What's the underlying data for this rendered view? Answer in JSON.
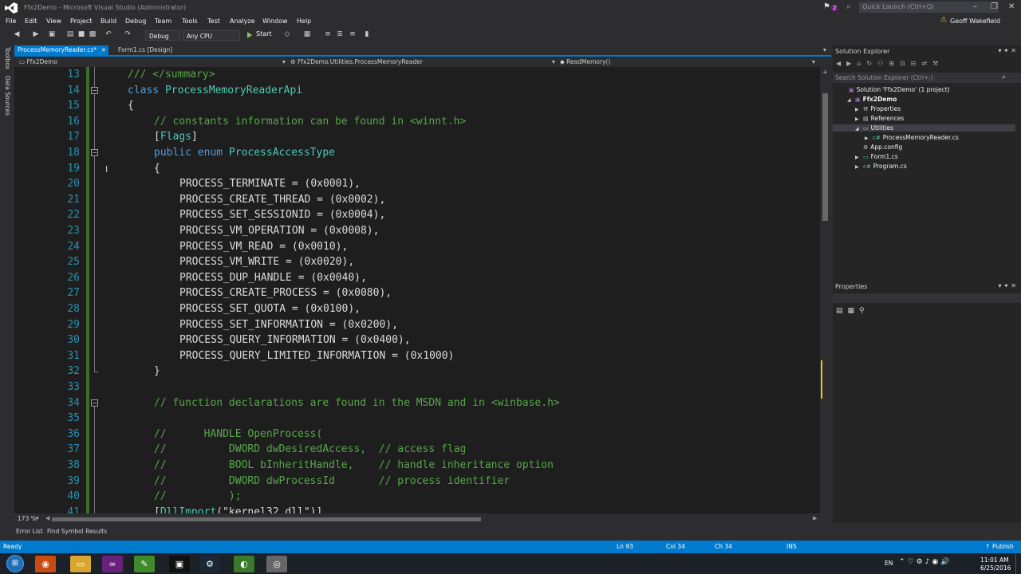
{
  "window": {
    "title": "Ffx2Demo - Microsoft Visual Studio (Administrator)",
    "notifications_count": "2",
    "quick_launch_placeholder": "Quick Launch (Ctrl+Q)",
    "user": "Geoff Wakefield"
  },
  "menu": [
    "File",
    "Edit",
    "View",
    "Project",
    "Build",
    "Debug",
    "Team",
    "Tools",
    "Test",
    "Analyze",
    "Window",
    "Help"
  ],
  "toolbar": {
    "config": "Debug",
    "platform": "Any CPU",
    "start_label": "Start"
  },
  "left_strip": {
    "toolbox": "Toolbox",
    "data_sources": "Data Sources"
  },
  "tabs": [
    {
      "label": "ProcessMemoryReader.cs*",
      "active": true
    },
    {
      "label": "Form1.cs [Design]",
      "active": false
    }
  ],
  "navbar": {
    "project": "Ffx2Demo",
    "class": "Ffx2Demo.Utilities.ProcessMemoryReader",
    "member": "ReadMemory()"
  },
  "code_lines": [
    {
      "num": "13",
      "indent": 0,
      "parts": [
        {
          "t": "/// </summary>",
          "c": "cm"
        }
      ]
    },
    {
      "num": "14",
      "indent": 0,
      "parts": [
        {
          "t": "class ",
          "c": "kw"
        },
        {
          "t": "ProcessMemoryReaderApi",
          "c": "ty"
        }
      ]
    },
    {
      "num": "15",
      "indent": 0,
      "parts": [
        {
          "t": "{",
          "c": "pl"
        }
      ]
    },
    {
      "num": "16",
      "indent": 1,
      "parts": [
        {
          "t": "// constants information can be found in <winnt.h>",
          "c": "cm"
        }
      ]
    },
    {
      "num": "17",
      "indent": 1,
      "parts": [
        {
          "t": "[",
          "c": "pl"
        },
        {
          "t": "Flags",
          "c": "ty"
        },
        {
          "t": "]",
          "c": "pl"
        }
      ]
    },
    {
      "num": "18",
      "indent": 1,
      "parts": [
        {
          "t": "public enum ",
          "c": "kw"
        },
        {
          "t": "ProcessAccessType",
          "c": "ty"
        }
      ]
    },
    {
      "num": "19",
      "indent": 1,
      "parts": [
        {
          "t": "{",
          "c": "pl"
        }
      ]
    },
    {
      "num": "20",
      "indent": 2,
      "parts": [
        {
          "t": "PROCESS_TERMINATE = (0x0001),",
          "c": "pl"
        }
      ]
    },
    {
      "num": "21",
      "indent": 2,
      "parts": [
        {
          "t": "PROCESS_CREATE_THREAD = (0x0002),",
          "c": "pl"
        }
      ]
    },
    {
      "num": "22",
      "indent": 2,
      "parts": [
        {
          "t": "PROCESS_SET_SESSIONID = (0x0004),",
          "c": "pl"
        }
      ]
    },
    {
      "num": "23",
      "indent": 2,
      "parts": [
        {
          "t": "PROCESS_VM_OPERATION = (0x0008),",
          "c": "pl"
        }
      ]
    },
    {
      "num": "24",
      "indent": 2,
      "parts": [
        {
          "t": "PROCESS_VM_READ = (0x0010),",
          "c": "pl"
        }
      ]
    },
    {
      "num": "25",
      "indent": 2,
      "parts": [
        {
          "t": "PROCESS_VM_WRITE = (0x0020),",
          "c": "pl"
        }
      ]
    },
    {
      "num": "26",
      "indent": 2,
      "parts": [
        {
          "t": "PROCESS_DUP_HANDLE = (0x0040),",
          "c": "pl"
        }
      ]
    },
    {
      "num": "27",
      "indent": 2,
      "parts": [
        {
          "t": "PROCESS_CREATE_PROCESS = (0x0080),",
          "c": "pl"
        }
      ]
    },
    {
      "num": "28",
      "indent": 2,
      "parts": [
        {
          "t": "PROCESS_SET_QUOTA = (0x0100),",
          "c": "pl"
        }
      ]
    },
    {
      "num": "29",
      "indent": 2,
      "parts": [
        {
          "t": "PROCESS_SET_INFORMATION = (0x0200),",
          "c": "pl"
        }
      ]
    },
    {
      "num": "30",
      "indent": 2,
      "parts": [
        {
          "t": "PROCESS_QUERY_INFORMATION = (0x0400),",
          "c": "pl"
        }
      ]
    },
    {
      "num": "31",
      "indent": 2,
      "parts": [
        {
          "t": "PROCESS_QUERY_LIMITED_INFORMATION = (0x1000)",
          "c": "pl"
        }
      ]
    },
    {
      "num": "32",
      "indent": 1,
      "parts": [
        {
          "t": "}",
          "c": "pl"
        }
      ]
    },
    {
      "num": "33",
      "indent": 0,
      "parts": []
    },
    {
      "num": "34",
      "indent": 1,
      "parts": [
        {
          "t": "// function declarations are found in the MSDN and in <winbase.h>",
          "c": "cm"
        }
      ]
    },
    {
      "num": "35",
      "indent": 0,
      "parts": []
    },
    {
      "num": "36",
      "indent": 1,
      "parts": [
        {
          "t": "//      HANDLE OpenProcess(",
          "c": "cm"
        }
      ]
    },
    {
      "num": "37",
      "indent": 1,
      "parts": [
        {
          "t": "//          DWORD dwDesiredAccess,  // access flag",
          "c": "cm"
        }
      ]
    },
    {
      "num": "38",
      "indent": 1,
      "parts": [
        {
          "t": "//          BOOL bInheritHandle,    // handle inheritance option",
          "c": "cm"
        }
      ]
    },
    {
      "num": "39",
      "indent": 1,
      "parts": [
        {
          "t": "//          DWORD dwProcessId       // process identifier",
          "c": "cm"
        }
      ]
    },
    {
      "num": "40",
      "indent": 1,
      "parts": [
        {
          "t": "//          );",
          "c": "cm"
        }
      ]
    },
    {
      "num": "41",
      "indent": 1,
      "parts": [
        {
          "t": "[",
          "c": "pl"
        },
        {
          "t": "DllImport",
          "c": "ty"
        },
        {
          "t": "(\"kernel32.dll\")]",
          "c": "pl"
        }
      ]
    }
  ],
  "zoom": "173 %",
  "solution_explorer": {
    "title": "Solution Explorer",
    "search_placeholder": "Search Solution Explorer (Ctrl+;)",
    "items": [
      {
        "label": "Solution 'Ffx2Demo' (1 project)",
        "level": 0,
        "arrow": ""
      },
      {
        "label": "Ffx2Demo",
        "level": 1,
        "arrow": "▲"
      },
      {
        "label": "Properties",
        "level": 2,
        "arrow": "▶"
      },
      {
        "label": "References",
        "level": 2,
        "arrow": "▶"
      },
      {
        "label": "Utilities",
        "level": 2,
        "arrow": "▲"
      },
      {
        "label": "ProcessMemoryReader.cs",
        "level": 3,
        "arrow": "▶"
      },
      {
        "label": "App.config",
        "level": 2,
        "arrow": ""
      },
      {
        "label": "Form1.cs",
        "level": 2,
        "arrow": "▶"
      },
      {
        "label": "Program.cs",
        "level": 2,
        "arrow": "▶"
      }
    ]
  },
  "properties_panel": {
    "title": "Properties"
  },
  "bottom_tabs": [
    "Error List",
    "Find Symbol Results"
  ],
  "status": {
    "ready": "Ready",
    "ln": "Ln 93",
    "col": "Col 34",
    "ch": "Ch 34",
    "ins": "INS",
    "publish": "Publish"
  },
  "taskbar": {
    "lang": "EN",
    "time": "11:01 AM",
    "date": "6/25/2016"
  },
  "colors": {
    "accent": "#007acc",
    "keyword": "#569cd6",
    "type": "#4ec9b0",
    "comment": "#57a64a"
  }
}
